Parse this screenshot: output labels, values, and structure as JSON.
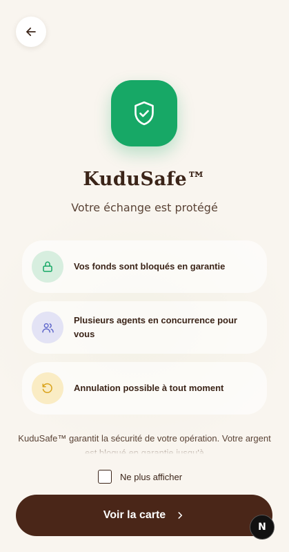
{
  "header": {
    "back_icon": "arrow-left-icon"
  },
  "hero": {
    "icon": "shield-check-icon",
    "title": "KuduSafe™",
    "subtitle": "Votre échange est protégé"
  },
  "features": [
    {
      "icon": "lock-icon",
      "text": "Vos fonds sont bloqués en garantie"
    },
    {
      "icon": "users-icon",
      "text": "Plusieurs agents en concurrence pour vous"
    },
    {
      "icon": "rotate-ccw-icon",
      "text": "Annulation possible à tout moment"
    }
  ],
  "note": "KuduSafe™ garantit la sécurité de votre opération. Votre argent est bloqué en garantie jusqu'à",
  "dont_show": {
    "label": "Ne plus afficher",
    "checked": false
  },
  "cta": {
    "label": "Voir la carte",
    "icon": "chevron-right-icon"
  },
  "dev_badge": {
    "label": "N"
  },
  "colors": {
    "accent_green": "#17a866",
    "primary_brown": "#4a2618",
    "text": "#3b2418",
    "background": "#f9f5ef"
  }
}
